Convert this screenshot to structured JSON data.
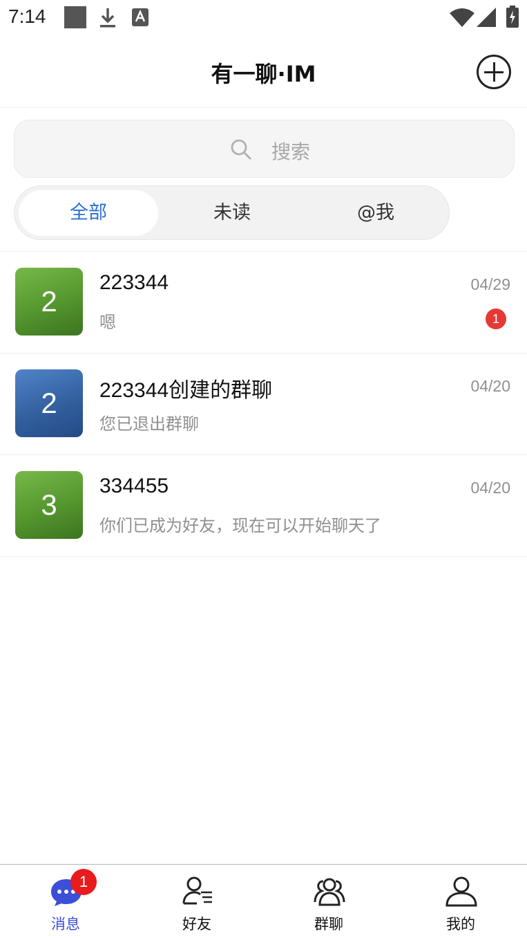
{
  "status_bar": {
    "time": "7:14",
    "icons": [
      "square-notification-icon",
      "download-icon",
      "text-a-icon",
      "wifi-icon",
      "signal-icon",
      "battery-charging-icon"
    ]
  },
  "header": {
    "title": "有一聊·IM",
    "add_icon": "plus-circle-icon"
  },
  "search": {
    "placeholder": "搜索",
    "icon": "search-icon"
  },
  "filter_tabs": [
    {
      "label": "全部",
      "active": true
    },
    {
      "label": "未读",
      "active": false
    },
    {
      "label": "@我",
      "active": false
    }
  ],
  "conversations": [
    {
      "avatar_text": "2",
      "avatar_color": "#5a9a30",
      "name": "223344",
      "preview": "嗯",
      "time": "04/29",
      "unread": "1"
    },
    {
      "avatar_text": "2",
      "avatar_color": "#2f5c9c",
      "name": "223344创建的群聊",
      "preview": "您已退出群聊",
      "time": "04/20",
      "unread": ""
    },
    {
      "avatar_text": "3",
      "avatar_color": "#5a9a30",
      "name": "334455",
      "preview": "你们已成为好友，现在可以开始聊天了",
      "time": "04/20",
      "unread": ""
    }
  ],
  "bottom_nav": {
    "items": [
      {
        "label": "消息",
        "icon": "chat-bubble-icon",
        "active": true,
        "badge": "1"
      },
      {
        "label": "好友",
        "icon": "friends-list-icon",
        "active": false
      },
      {
        "label": "群聊",
        "icon": "group-icon",
        "active": false
      },
      {
        "label": "我的",
        "icon": "profile-icon",
        "active": false
      }
    ]
  },
  "colors": {
    "accent": "#2d6fd6",
    "nav_active": "#3a4fd8",
    "badge_red": "#e53935"
  }
}
